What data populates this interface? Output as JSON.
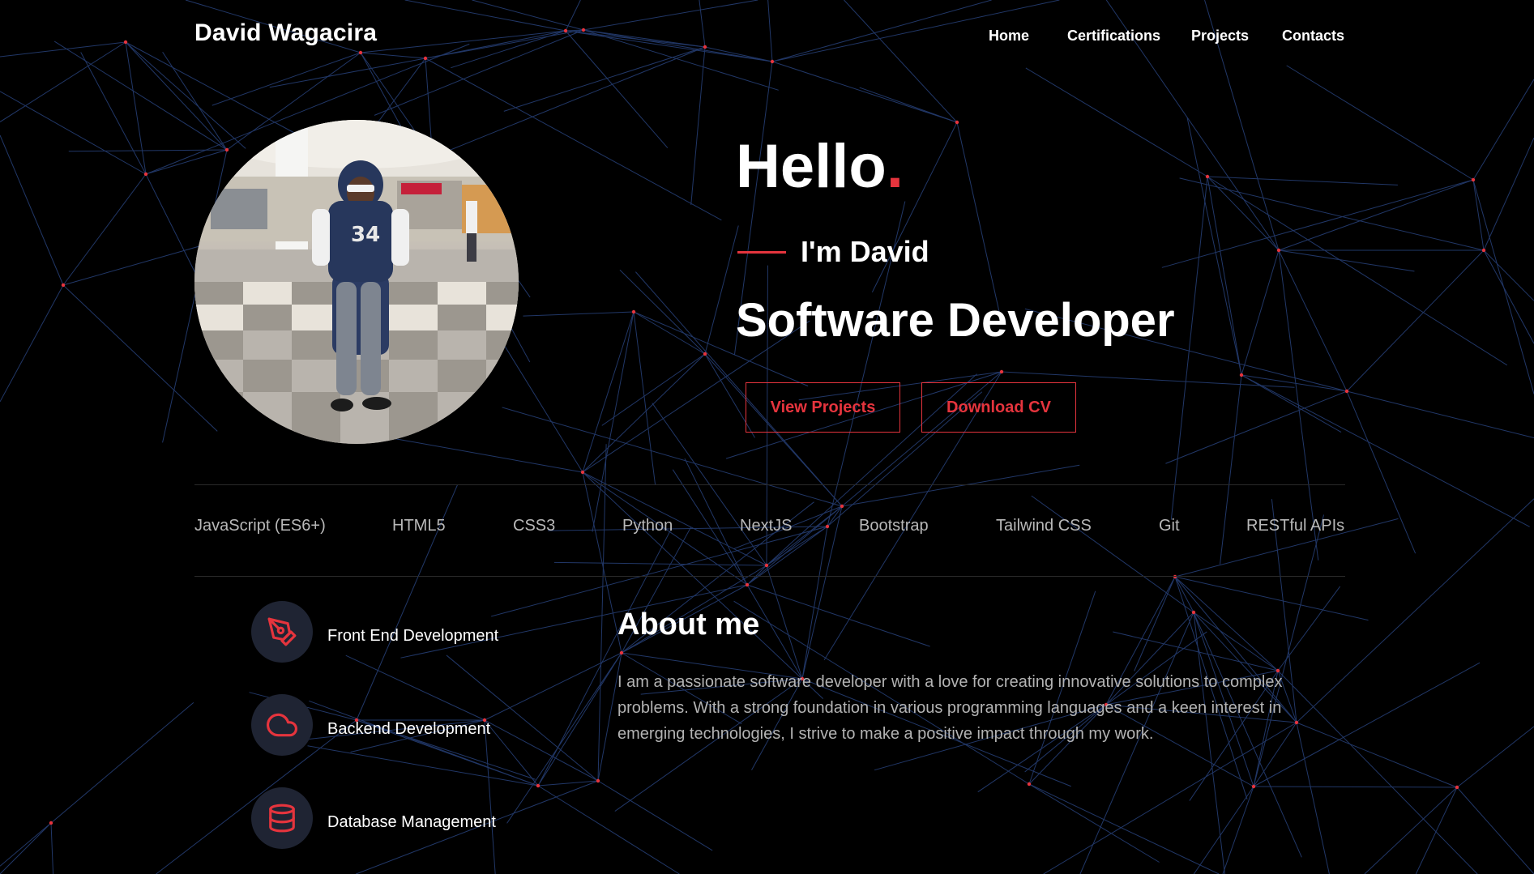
{
  "header": {
    "logo": "David Wagacira",
    "nav": [
      "Home",
      "Certifications",
      "Projects",
      "Contacts"
    ]
  },
  "hero": {
    "greeting": "Hello",
    "greeting_dot": ".",
    "intro": "I'm David",
    "role": "Software Developer",
    "buttons": {
      "view_projects": "View Projects",
      "download_cv": "Download CV"
    },
    "photo_icon": "profile-photo"
  },
  "skills": [
    "JavaScript (ES6+)",
    "HTML5",
    "CSS3",
    "Python",
    "NextJS",
    "Bootstrap",
    "Tailwind CSS",
    "Git",
    "RESTful APIs"
  ],
  "services": [
    {
      "label": "Front End Development",
      "icon": "pen-tool-icon"
    },
    {
      "label": "Backend Development",
      "icon": "cloud-icon"
    },
    {
      "label": "Database Management",
      "icon": "database-icon"
    }
  ],
  "about": {
    "title": "About me",
    "body": "I am a passionate software developer with a love for creating innovative solutions to complex problems. With a strong foundation in various programming languages and a keen interest in emerging technologies, I strive to make a positive impact through my work."
  },
  "colors": {
    "accent": "#e5343d",
    "background": "#000000",
    "network_line": "#2d4a8a",
    "network_node": "#e5343d",
    "icon_circle": "#1f2433"
  }
}
